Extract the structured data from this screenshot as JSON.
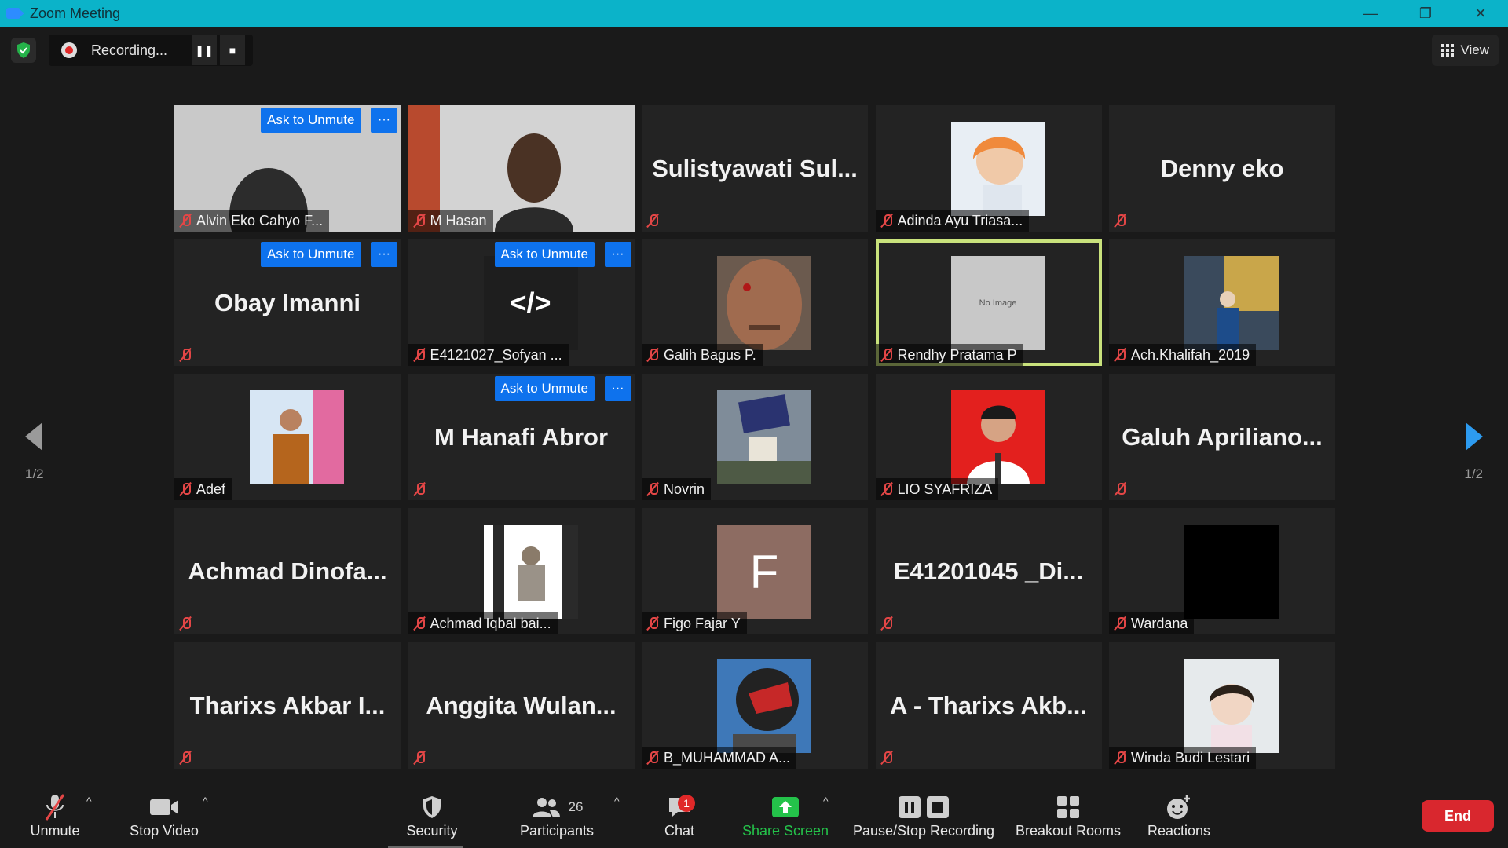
{
  "window": {
    "title": "Zoom Meeting",
    "minimize": "—",
    "restore": "❐",
    "close": "✕"
  },
  "recording": {
    "text": "Recording...",
    "pause": "❚❚",
    "stop": "■"
  },
  "view_button": {
    "label": "View"
  },
  "ask_to_unmute": "Ask to Unmute",
  "more_glyph": "···",
  "page_indicator": "1/2",
  "tiles": [
    {
      "name": "Alvin Eko Cahyo F...",
      "big": "",
      "img": "photo",
      "ask": true
    },
    {
      "name": "M Hasan",
      "big": "",
      "img": "photo",
      "ask": false
    },
    {
      "name": "",
      "big": "Sulistyawati  Sul...",
      "img": "",
      "ask": false
    },
    {
      "name": "Adinda Ayu Triasa...",
      "big": "",
      "img": "avatar-orange",
      "ask": false
    },
    {
      "name": "",
      "big": "Denny eko",
      "img": "",
      "ask": false
    },
    {
      "name": "",
      "big": "Obay Imanni",
      "img": "",
      "ask": true
    },
    {
      "name": "E4121027_Sofyan ...",
      "big": "",
      "img": "code",
      "ask": true
    },
    {
      "name": "Galih Bagus P.",
      "big": "",
      "img": "avatar-face",
      "ask": false
    },
    {
      "name": "Rendhy Pratama P",
      "big": "",
      "img": "noimage",
      "ask": false
    },
    {
      "name": "Ach.Khalifah_2019",
      "big": "",
      "img": "avatar-sign",
      "ask": false
    },
    {
      "name": "Adef",
      "big": "",
      "img": "avatar-batik",
      "ask": false
    },
    {
      "name": "",
      "big": "M Hanafi Abror",
      "img": "",
      "ask": true
    },
    {
      "name": "Novrin",
      "big": "",
      "img": "avatar-crowd",
      "ask": false
    },
    {
      "name": "LIO SYAFRIZA",
      "big": "",
      "img": "avatar-red",
      "ask": false
    },
    {
      "name": "",
      "big": "Galuh  Apriliano...",
      "img": "",
      "ask": false
    },
    {
      "name": "",
      "big": "Achmad  Dinofa...",
      "img": "",
      "ask": false
    },
    {
      "name": "Achmad Iqbal bai...",
      "big": "",
      "img": "avatar-white",
      "ask": false
    },
    {
      "name": "Figo Fajar Y",
      "big": "",
      "img": "letter",
      "ask": false
    },
    {
      "name": "",
      "big": "E41201045  _Di...",
      "img": "",
      "ask": false
    },
    {
      "name": "Wardana",
      "big": "",
      "img": "avatar-black",
      "ask": false
    },
    {
      "name": "",
      "big": "Tharixs  Akbar  I...",
      "img": "",
      "ask": false
    },
    {
      "name": "",
      "big": "Anggita  Wulan...",
      "img": "",
      "ask": false
    },
    {
      "name": "B_MUHAMMAD A...",
      "big": "",
      "img": "avatar-helmet",
      "ask": false
    },
    {
      "name": "",
      "big": "A  -  Tharixs  Akb...",
      "img": "",
      "ask": false
    },
    {
      "name": "Winda Budi Lestari",
      "big": "",
      "img": "avatar-child",
      "ask": false
    }
  ],
  "tile_texts": {
    "no_image": "No Image",
    "code_glyph": "</>",
    "letter": "F"
  },
  "toolbar": {
    "unmute": "Unmute",
    "stop_video": "Stop Video",
    "security": "Security",
    "participants": "Participants",
    "participants_count": "26",
    "chat": "Chat",
    "chat_badge": "1",
    "share_screen": "Share Screen",
    "pause_stop_recording": "Pause/Stop Recording",
    "breakout_rooms": "Breakout Rooms",
    "reactions": "Reactions",
    "end": "End"
  },
  "colors": {
    "titlebar": "#0bb3c9",
    "ask_button": "#0e72ed",
    "end_button": "#d9272e",
    "active_speaker": "#c9e27c",
    "share_green": "#24c24a"
  }
}
